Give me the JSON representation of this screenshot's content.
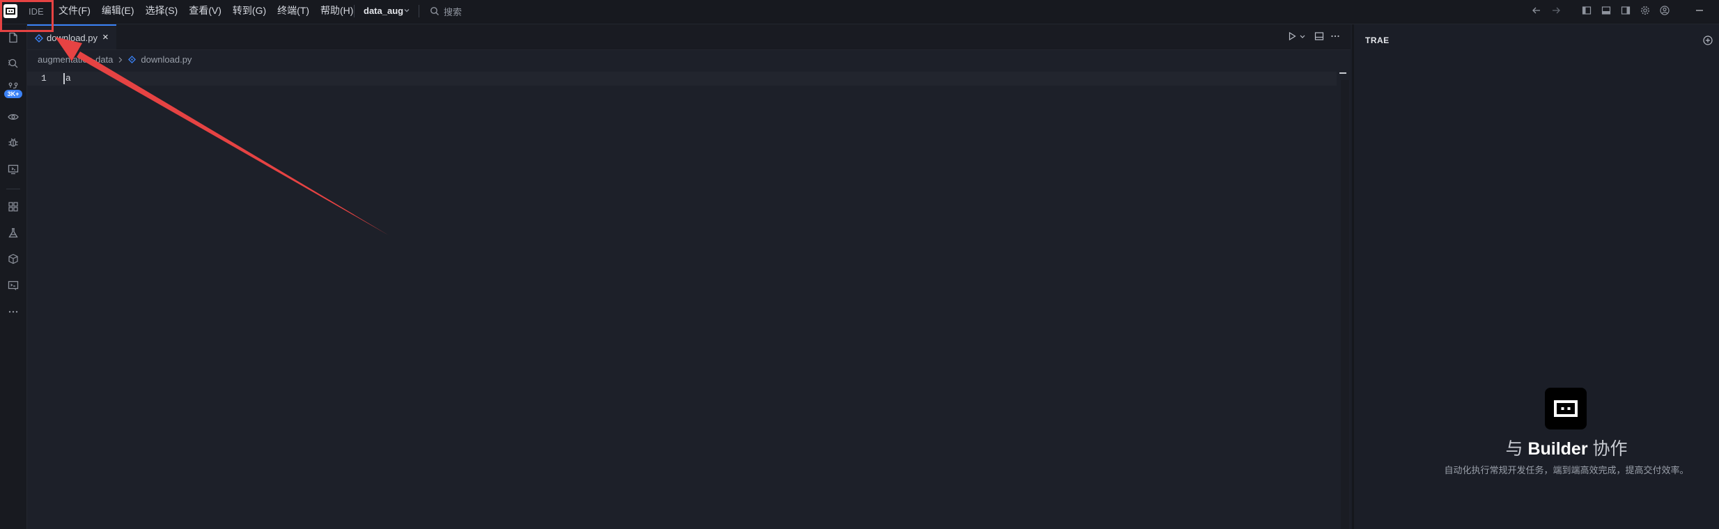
{
  "titlebar": {
    "mode_label": "IDE",
    "menu": [
      "文件(F)",
      "编辑(E)",
      "选择(S)",
      "查看(V)",
      "转到(G)",
      "终端(T)",
      "帮助(H)"
    ],
    "project_name": "data_aug",
    "search_placeholder": "搜索"
  },
  "activity_bar": {
    "badge": "3K+",
    "icons": [
      "explorer-icon",
      "search-icon",
      "source-control-icon",
      "preview-icon",
      "debug-icon",
      "remote-icon",
      "extensions-icon",
      "testing-icon",
      "package-icon",
      "terminal-icon",
      "more-icon"
    ]
  },
  "editor": {
    "tab": {
      "label": "download.py",
      "close": "×"
    },
    "breadcrumb": {
      "folder": "augmentation-data",
      "file": "download.py"
    },
    "lines": [
      {
        "number": "1",
        "text": "a"
      }
    ]
  },
  "right_panel": {
    "title": "TRAE",
    "builder": {
      "title_prefix": "与",
      "title_name": "Builder",
      "title_suffix": "协作",
      "subtitle": "自动化执行常规开发任务，端到端高效完成，提高交付效率。"
    }
  },
  "colors": {
    "accent": "#3a82f7",
    "annotation": "#e64343",
    "background": "#1b1e27"
  }
}
